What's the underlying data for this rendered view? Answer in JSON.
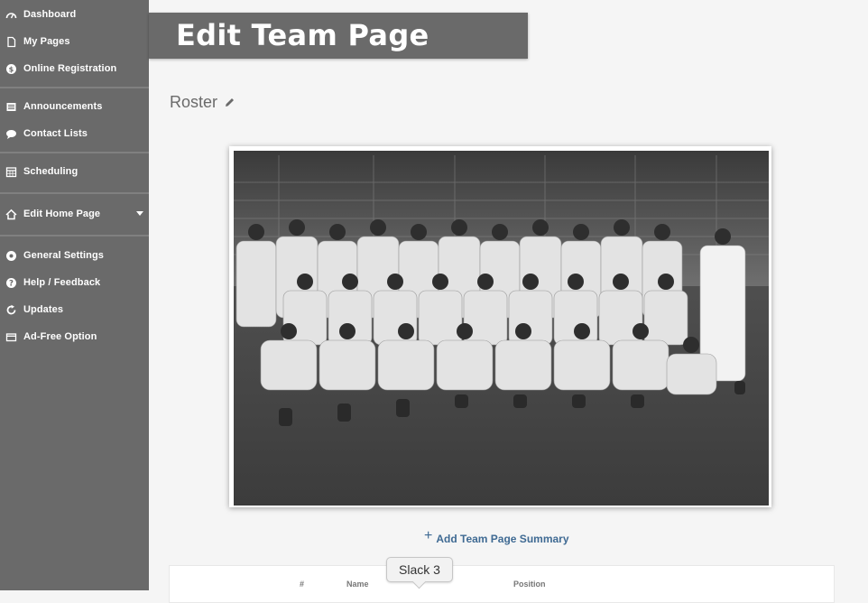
{
  "sidebar": {
    "groups": [
      {
        "items": [
          {
            "label": "Dashboard",
            "icon": "dashboard-icon"
          },
          {
            "label": "My Pages",
            "icon": "page-icon"
          },
          {
            "label": "Online Registration",
            "icon": "dollar-icon"
          }
        ]
      },
      {
        "items": [
          {
            "label": "Announcements",
            "icon": "newspaper-icon"
          },
          {
            "label": "Contact Lists",
            "icon": "chat-bubble-icon"
          }
        ]
      },
      {
        "items": [
          {
            "label": "Scheduling",
            "icon": "calendar-icon"
          }
        ]
      },
      {
        "items": [
          {
            "label": "Edit Home Page",
            "icon": "home-icon",
            "has_dropdown": true
          }
        ]
      },
      {
        "items": [
          {
            "label": "General Settings",
            "icon": "gear-icon"
          },
          {
            "label": "Help / Feedback",
            "icon": "question-icon"
          },
          {
            "label": "Updates",
            "icon": "refresh-icon"
          },
          {
            "label": "Ad-Free Option",
            "icon": "card-icon"
          }
        ]
      }
    ]
  },
  "header": {
    "title": "Edit Team Page"
  },
  "roster": {
    "title": "Roster"
  },
  "actions": {
    "add_summary_label": "Add Team Page Summary"
  },
  "table": {
    "columns": [
      "#",
      "Name",
      "Position"
    ]
  },
  "tooltip": {
    "text": "Slack 3"
  },
  "colors": {
    "sidebar_bg": "#6a6a6a",
    "banner_bg": "#6a6a6a",
    "link": "#3f6a93",
    "page_bg": "#f5f5f5"
  }
}
